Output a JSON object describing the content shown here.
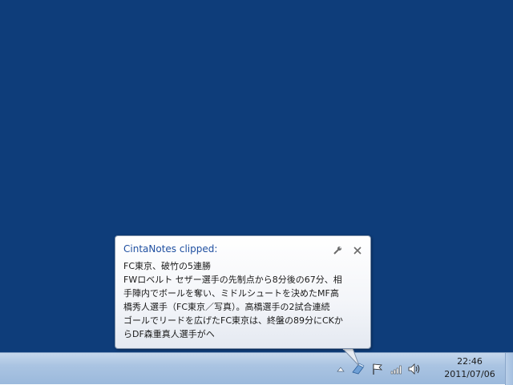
{
  "balloon": {
    "title": "CintaNotes clipped:",
    "lines": [
      "FC東京、破竹の5連勝",
      "FWロベルト セザー選手の先制点から8分後の67分、相",
      "手陣内でボールを奪い、ミドルシュートを決めたMF高",
      "橋秀人選手（FC東京／写真）。高橋選手の2試合連続",
      "ゴールでリードを広げたFC東京は、終盤の89分にCKか",
      "らDF森重真人選手がヘ"
    ]
  },
  "taskbar": {
    "clock_time": "22:46",
    "clock_date": "2011/07/06",
    "tray_icons": [
      "show-hidden-icons-icon",
      "cintanotes-icon",
      "flag-icon",
      "network-icon",
      "volume-icon"
    ]
  },
  "colors": {
    "desktop": "#0e3d7a",
    "title": "#1f4fa0"
  }
}
